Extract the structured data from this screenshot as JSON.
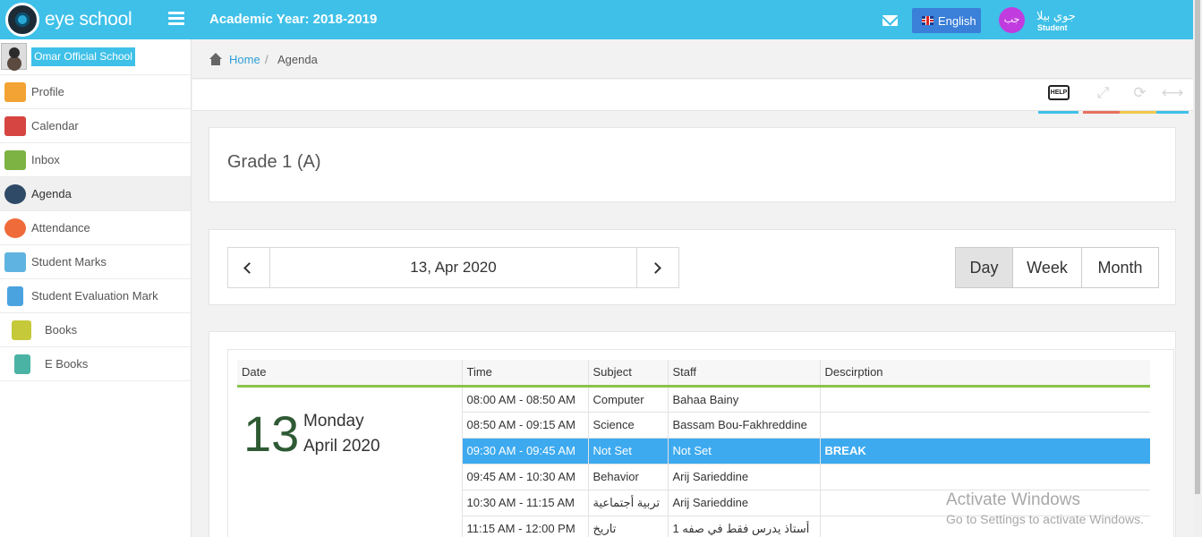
{
  "header": {
    "logo_text": "eye school",
    "academic_year": "Academic Year: 2018-2019",
    "language": "English",
    "user": {
      "initials": "جب",
      "name": "جوي بيلا",
      "role": "Student"
    }
  },
  "sidebar": {
    "school_name": "Omar Official School",
    "items": [
      {
        "label": "Profile",
        "icon_color": "#f3a333"
      },
      {
        "label": "Calendar",
        "icon_color": "#d64541"
      },
      {
        "label": "Inbox",
        "icon_color": "#7cb342"
      },
      {
        "label": "Agenda",
        "icon_color": "#2f4a66"
      },
      {
        "label": "Attendance",
        "icon_color": "#ef6b3a"
      },
      {
        "label": "Student Marks",
        "icon_color": "#5fb3e0"
      },
      {
        "label": "Student Evaluation Mark",
        "icon_color": "#4aa3df"
      },
      {
        "label": "Books",
        "icon_color": "#c5c93a"
      },
      {
        "label": "E Books",
        "icon_color": "#4ab3a4"
      }
    ],
    "active": "Agenda"
  },
  "breadcrumb": {
    "home": "Home",
    "separator": "/",
    "current": "Agenda"
  },
  "toolbar": {
    "help": "HELP",
    "colors": [
      "#3ec0e8",
      "#e8705f",
      "#f2c94c",
      "#3ec0e8"
    ]
  },
  "class_panel": {
    "title": "Grade 1 (A)"
  },
  "date_nav": {
    "current_date": "13, Apr 2020",
    "views": [
      "Day",
      "Week",
      "Month"
    ],
    "active_view": "Day"
  },
  "agenda": {
    "columns": [
      "Date",
      "Time",
      "Subject",
      "Staff",
      "Descirption"
    ],
    "date": {
      "day": "13",
      "weekday": "Monday",
      "month_year": "April 2020"
    },
    "rows": [
      {
        "time": "08:00 AM - 08:50 AM",
        "subject": "Computer",
        "staff": "Bahaa Bainy",
        "description": ""
      },
      {
        "time": "08:50 AM - 09:15 AM",
        "subject": "Science",
        "staff": "Bassam Bou-Fakhreddine",
        "description": ""
      },
      {
        "time": "09:30 AM - 09:45 AM",
        "subject": "Not Set",
        "staff": "Not Set",
        "description": "BREAK",
        "highlight": true
      },
      {
        "time": "09:45 AM - 10:30 AM",
        "subject": "Behavior",
        "staff": "Arij Sarieddine",
        "description": ""
      },
      {
        "time": "10:30 AM - 11:15 AM",
        "subject": "تربية أجتماعية",
        "staff": "Arij Sarieddine",
        "description": ""
      },
      {
        "time": "11:15 AM - 12:00 PM",
        "subject": "تاريخ",
        "staff": "أستاذ يدرس فقط في صفه 1",
        "description": ""
      }
    ],
    "highlight_color": "#3daaf0",
    "header_rule_color": "#8bc44a"
  },
  "watermark": {
    "title": "Activate Windows",
    "subtitle": "Go to Settings to activate Windows."
  }
}
